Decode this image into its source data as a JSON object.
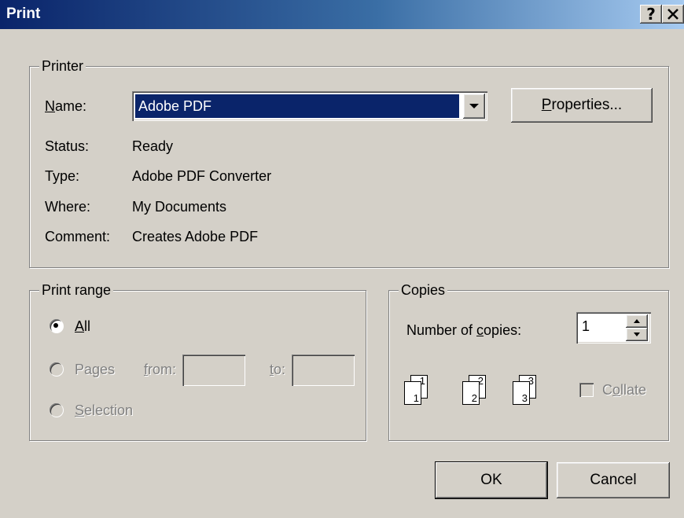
{
  "window": {
    "title": "Print",
    "help_glyph": "?"
  },
  "printer": {
    "legend": "Printer",
    "name_label_u": "N",
    "name_label_rest": "ame:",
    "selected_printer": "Adobe PDF",
    "properties_u": "P",
    "properties_rest": "roperties...",
    "status_label": "Status:",
    "status_value": "Ready",
    "type_label": "Type:",
    "type_value": "Adobe PDF Converter",
    "where_label": "Where:",
    "where_value": "My Documents",
    "comment_label": "Comment:",
    "comment_value": "Creates Adobe PDF"
  },
  "print_range": {
    "legend": "Print range",
    "all_u": "A",
    "all_rest": "ll",
    "pages_pre": "Pa",
    "pages_u": "g",
    "pages_post": "es",
    "from_u": "f",
    "from_rest": "rom:",
    "to_u": "t",
    "to_rest": "o:",
    "selection_u": "S",
    "selection_rest": "election",
    "selected": "All"
  },
  "copies": {
    "legend": "Copies",
    "number_pre": "Number of ",
    "number_u": "c",
    "number_post": "opies:",
    "value": "1",
    "collate_pre": "C",
    "collate_u": "o",
    "collate_post": "llate",
    "collate_checked": false,
    "page_labels": [
      "1",
      "1",
      "2",
      "2",
      "3",
      "3"
    ]
  },
  "buttons": {
    "ok": "OK",
    "cancel": "Cancel"
  }
}
